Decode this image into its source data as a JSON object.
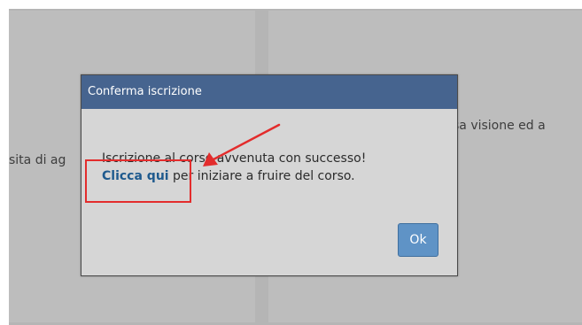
{
  "background": {
    "left_text": "sita di ag",
    "right_text": "sa visione ed a"
  },
  "dialog": {
    "title": "Conferma iscrizione",
    "message_line1": "Iscrizione al corso avvenuta con successo!",
    "link_text": "Clicca qui",
    "message_line2_rest": " per iniziare a fruire del corso.",
    "ok_label": "Ok"
  },
  "colors": {
    "titlebar": "#46648f",
    "link": "#1f5a8e",
    "ok_button": "#5f93c6",
    "annotation": "#e32c2c"
  },
  "icons": {
    "annotation": "red-arrow-icon"
  }
}
